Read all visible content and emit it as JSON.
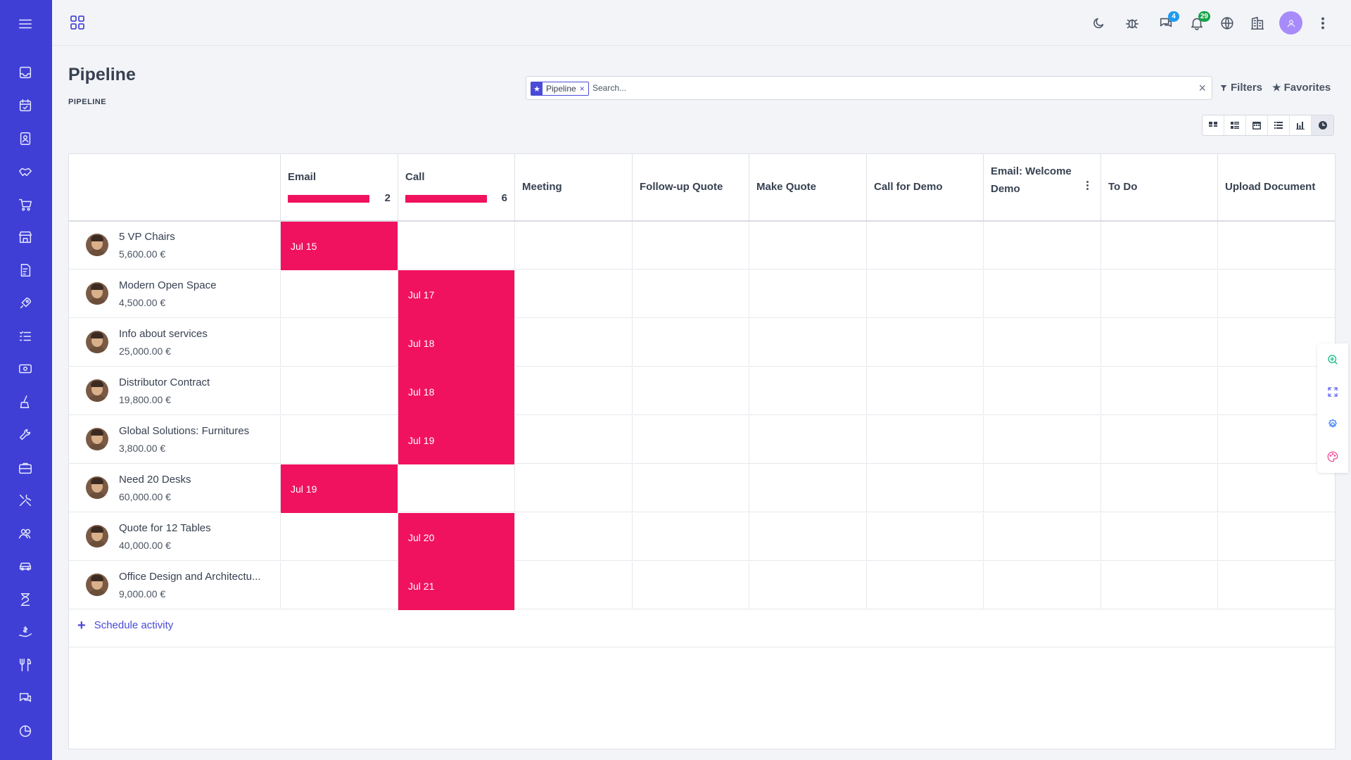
{
  "colors": {
    "sidebar_bg": "#3f3fd6",
    "accent": "#4a4ad8",
    "activity": "#f1125f",
    "badge_blue": "#1d9bf0",
    "badge_green": "#16a34a"
  },
  "sidebar": {
    "items": [
      {
        "icon": "menu-icon"
      },
      {
        "icon": "inbox-icon"
      },
      {
        "icon": "calendar-check-icon"
      },
      {
        "icon": "contacts-icon"
      },
      {
        "icon": "handshake-icon"
      },
      {
        "icon": "cart-icon"
      },
      {
        "icon": "store-icon"
      },
      {
        "icon": "invoice-icon"
      },
      {
        "icon": "rocket-icon"
      },
      {
        "icon": "checklist-icon"
      },
      {
        "icon": "money-icon"
      },
      {
        "icon": "broom-icon"
      },
      {
        "icon": "wrench-icon"
      },
      {
        "icon": "briefcase-icon"
      },
      {
        "icon": "tools-icon"
      },
      {
        "icon": "users-icon"
      },
      {
        "icon": "car-icon"
      },
      {
        "icon": "hourglass-icon"
      },
      {
        "icon": "donation-icon"
      },
      {
        "icon": "restaurant-icon"
      },
      {
        "icon": "chat-icon"
      },
      {
        "icon": "pie-chart-icon"
      }
    ]
  },
  "topbar": {
    "messages_badge": "4",
    "notifications_badge": "29"
  },
  "header": {
    "title": "Pipeline",
    "breadcrumb": "PIPELINE"
  },
  "search": {
    "facet_label": "Pipeline",
    "placeholder": "Search...",
    "filters_label": "Filters",
    "favorites_label": "Favorites"
  },
  "columns": [
    {
      "title": "Email",
      "count": "2",
      "progress": 1.0
    },
    {
      "title": "Call",
      "count": "6",
      "progress": 1.0
    },
    {
      "title": "Meeting"
    },
    {
      "title": "Follow-up Quote"
    },
    {
      "title": "Make Quote"
    },
    {
      "title": "Call for Demo"
    },
    {
      "title": "Email: Welcome Demo"
    },
    {
      "title": "To Do"
    },
    {
      "title": "Upload Document"
    }
  ],
  "rows": [
    {
      "name": "5 VP Chairs",
      "amount": "5,600.00 €",
      "activity_column": "Email",
      "activity_date": "Jul 15"
    },
    {
      "name": "Modern Open Space",
      "amount": "4,500.00 €",
      "activity_column": "Call",
      "activity_date": "Jul 17"
    },
    {
      "name": "Info about services",
      "amount": "25,000.00 €",
      "activity_column": "Call",
      "activity_date": "Jul 18"
    },
    {
      "name": "Distributor Contract",
      "amount": "19,800.00 €",
      "activity_column": "Call",
      "activity_date": "Jul 18"
    },
    {
      "name": "Global Solutions: Furnitures",
      "amount": "3,800.00 €",
      "activity_column": "Call",
      "activity_date": "Jul 19"
    },
    {
      "name": "Need 20 Desks",
      "amount": "60,000.00 €",
      "activity_column": "Email",
      "activity_date": "Jul 19"
    },
    {
      "name": "Quote for 12 Tables",
      "amount": "40,000.00 €",
      "activity_column": "Call",
      "activity_date": "Jul 20"
    },
    {
      "name": "Office Design and Architectu...",
      "amount": "9,000.00 €",
      "activity_column": "Call",
      "activity_date": "Jul 21"
    }
  ],
  "footer": {
    "schedule_label": "Schedule activity"
  }
}
